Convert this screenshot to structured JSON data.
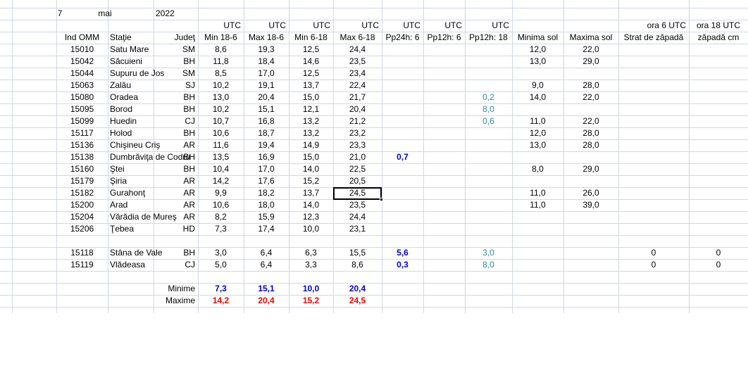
{
  "header": {
    "day": "7",
    "month": "mai",
    "year": "2022"
  },
  "utc_labels": [
    "UTC",
    "UTC",
    "UTC",
    "UTC",
    "UTC",
    "UTC",
    "UTC"
  ],
  "snow_time_labels": [
    "ora 6 UTC",
    "ora 18 UTC"
  ],
  "columns": [
    "Ind OMM",
    "Staţie",
    "Judeţ",
    "Min 18-6",
    "Max 18-6",
    "Min 6-18",
    "Max 6-18",
    "Pp24h: 6",
    "Pp12h: 6",
    "Pp12h: 18",
    "Minima sol",
    "Maxima sol",
    "Strat de zăpadă",
    "zăpadă cm"
  ],
  "rows": [
    [
      "15010",
      "Satu Mare",
      "SM",
      "8,6",
      "19,3",
      "12,5",
      "24,4",
      "",
      "",
      "",
      "12,0",
      "22,0",
      "",
      ""
    ],
    [
      "15042",
      "Săcuieni",
      "BH",
      "11,8",
      "18,4",
      "14,6",
      "23,5",
      "",
      "",
      "",
      "13,0",
      "29,0",
      "",
      ""
    ],
    [
      "15044",
      "Supuru de Jos",
      "SM",
      "8,5",
      "17,0",
      "12,5",
      "23,4",
      "",
      "",
      "",
      "",
      "",
      "",
      ""
    ],
    [
      "15063",
      "Zalău",
      "SJ",
      "10,2",
      "19,1",
      "13,7",
      "22,4",
      "",
      "",
      "",
      "9,0",
      "28,0",
      "",
      ""
    ],
    [
      "15080",
      "Oradea",
      "BH",
      "13,0",
      "20,4",
      "15,0",
      "21,7",
      "",
      "",
      "0,2",
      "14,0",
      "22,0",
      "",
      ""
    ],
    [
      "15095",
      "Borod",
      "BH",
      "10,2",
      "15,1",
      "12,1",
      "20,4",
      "",
      "",
      "8,0",
      "",
      "",
      "",
      ""
    ],
    [
      "15099",
      "Huedin",
      "CJ",
      "10,7",
      "16,8",
      "13,2",
      "21,2",
      "",
      "",
      "0,6",
      "11,0",
      "22,0",
      "",
      ""
    ],
    [
      "15117",
      "Holod",
      "BH",
      "10,6",
      "18,7",
      "13,2",
      "23,2",
      "",
      "",
      "",
      "12,0",
      "28,0",
      "",
      ""
    ],
    [
      "15136",
      "Chişineu     Criş",
      "AR",
      "11,6",
      "19,4",
      "14,9",
      "23,3",
      "",
      "",
      "",
      "13,0",
      "28,0",
      "",
      ""
    ],
    [
      "15138",
      "Dumbrăviţa    de Codru",
      "BH",
      "13,5",
      "16,9",
      "15,0",
      "21,0",
      "0,7",
      "",
      "",
      "",
      "",
      "",
      ""
    ],
    [
      "15160",
      "Ştei",
      "BH",
      "10,4",
      "17,0",
      "14,0",
      "22,5",
      "",
      "",
      "",
      "8,0",
      "29,0",
      "",
      ""
    ],
    [
      "15179",
      "Şiria",
      "AR",
      "14,2",
      "17,6",
      "15,2",
      "20,5",
      "",
      "",
      "",
      "",
      "",
      "",
      ""
    ],
    [
      "15182",
      "Gurahonţ",
      "AR",
      "9,9",
      "18,2",
      "13,7",
      "24,5",
      "",
      "",
      "",
      "11,0",
      "26,0",
      "",
      ""
    ],
    [
      "15200",
      "Arad",
      "AR",
      "10,6",
      "18,0",
      "14,0",
      "23,5",
      "",
      "",
      "",
      "11,0",
      "39,0",
      "",
      ""
    ],
    [
      "15204",
      "Vărădia de Mureş",
      "AR",
      "8,2",
      "15,9",
      "12,3",
      "24,4",
      "",
      "",
      "",
      "",
      "",
      "",
      ""
    ],
    [
      "15206",
      "Ţebea",
      "HD",
      "7,3",
      "17,4",
      "10,0",
      "23,1",
      "",
      "",
      "",
      "",
      "",
      "",
      ""
    ]
  ],
  "rows2": [
    [
      "15118",
      "Stâna de Vale",
      "BH",
      "3,0",
      "6,4",
      "6,3",
      "15,5",
      "5,6",
      "",
      "3,0",
      "",
      "",
      "0",
      "0"
    ],
    [
      "15119",
      "Vlădeasa",
      "CJ",
      "5,0",
      "6,4",
      "3,3",
      "8,6",
      "0,3",
      "",
      "8,0",
      "",
      "",
      "0",
      "0"
    ]
  ],
  "summary": [
    {
      "label": "Minime",
      "values": [
        "7,3",
        "15,1",
        "10,0",
        "20,4"
      ]
    },
    {
      "label": "Maxime",
      "values": [
        "14,2",
        "20,4",
        "15,2",
        "24,5"
      ]
    }
  ],
  "colors": {
    "gridline": "#d0d7e5",
    "precip_blue": "#0000cc",
    "precip12_teal": "#31869b",
    "min_blue": "#0000cc",
    "max_red": "#ee0000"
  }
}
